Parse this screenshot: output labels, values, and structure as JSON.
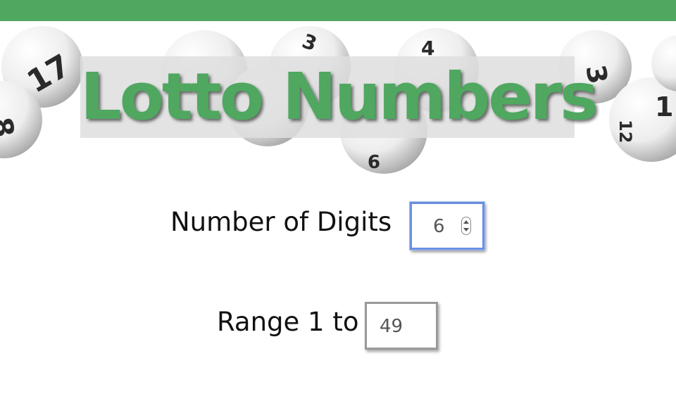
{
  "header": {
    "title": "Lotto Numbers",
    "accent_color": "#4fa760",
    "background_image": "lottery-balls"
  },
  "form": {
    "digits_label": "Number of Digits",
    "digits_value": "6",
    "range_label": "Range 1 to",
    "range_value": "49"
  }
}
